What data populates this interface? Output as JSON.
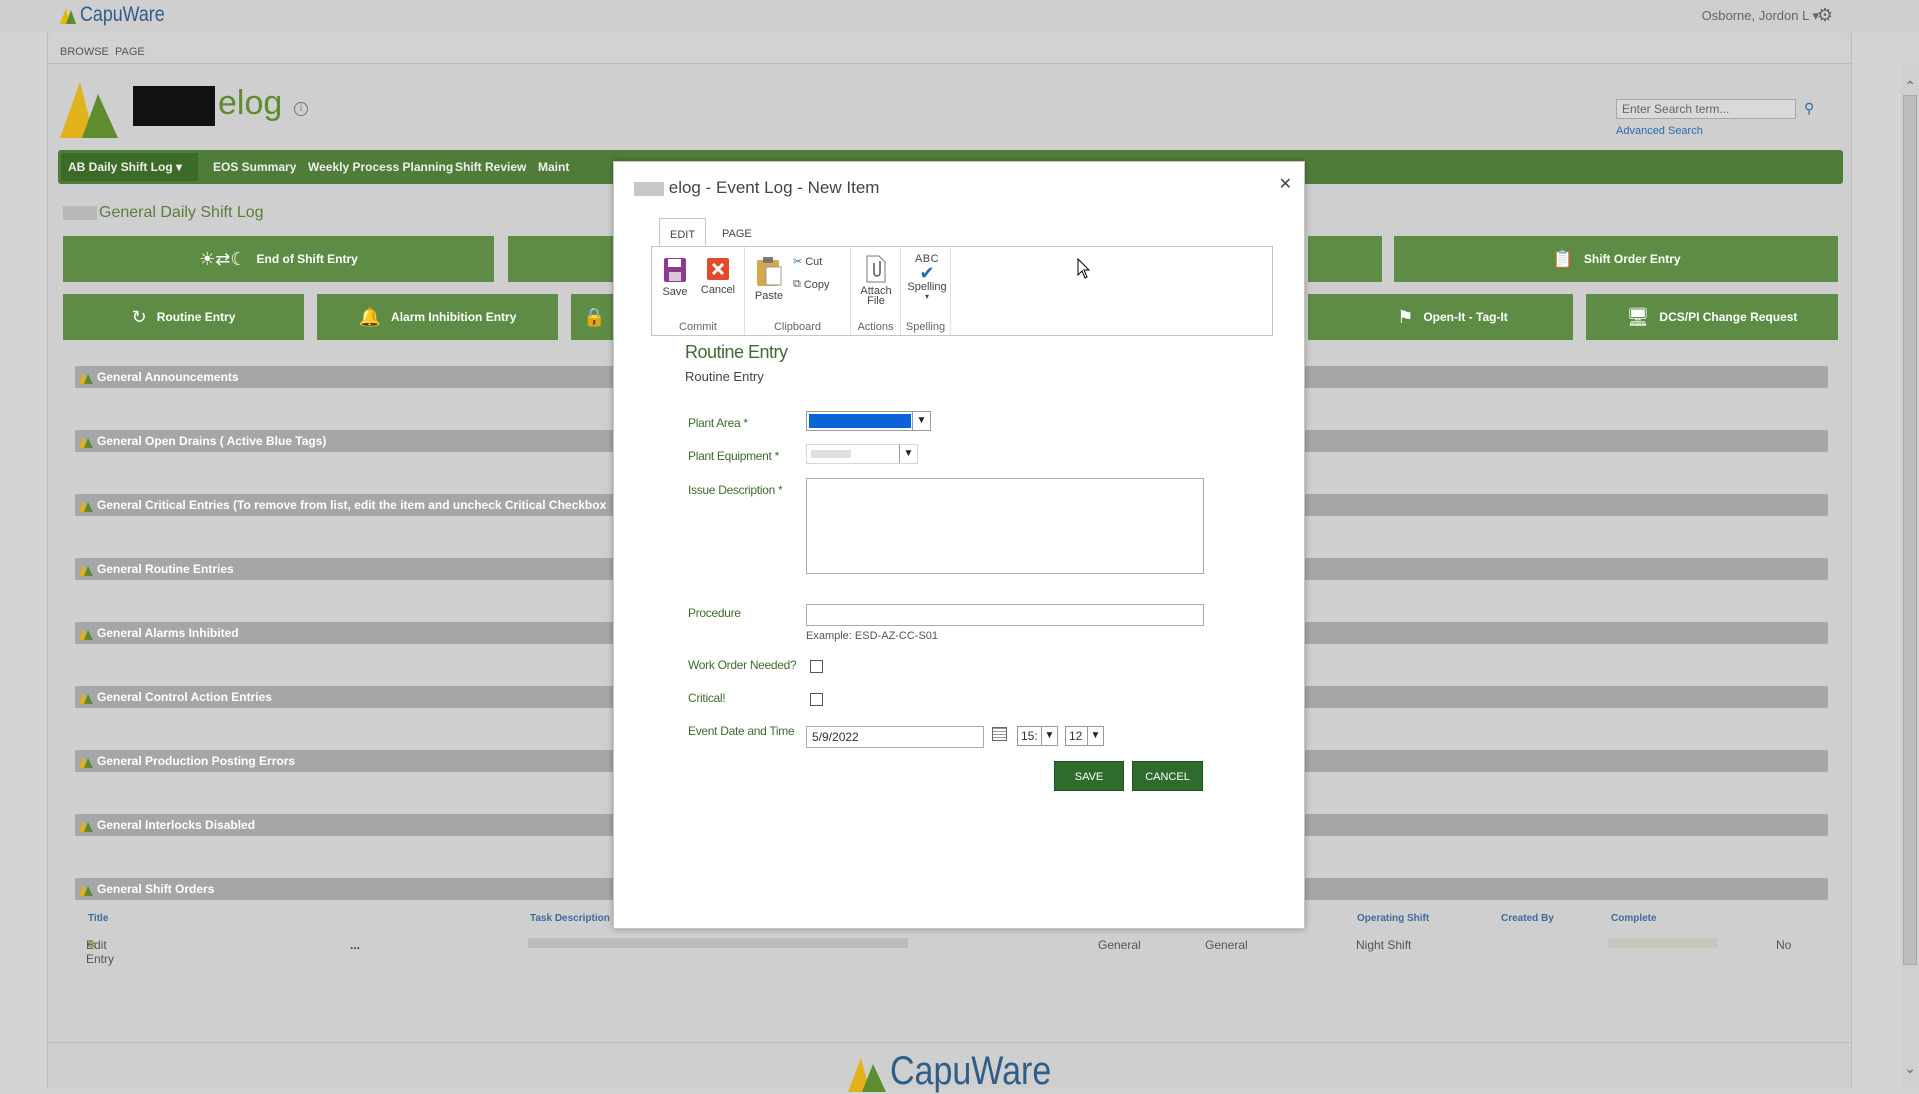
{
  "suitebar": {
    "brand": "CapuWare",
    "user": "Osborne, Jordon L",
    "user_caret": "▾"
  },
  "ribbon_tabs": {
    "browse": "BROWSE",
    "page": "PAGE"
  },
  "site": {
    "title": "elog",
    "search_placeholder": "Enter Search term...",
    "advanced_search": "Advanced Search"
  },
  "nav": {
    "items": [
      "AB Daily Shift Log ▾",
      "EOS Summary",
      "Weekly Process Planning",
      "Shift Review",
      "Maint"
    ]
  },
  "page_title": "General Daily Shift Log",
  "big_buttons": {
    "end_of_shift": "End of Shift Entry",
    "shift_order": "Shift Order Entry",
    "routine": "Routine Entry",
    "alarm_inhibition": "Alarm Inhibition Entry",
    "open_it_tag_it": "Open-It - Tag-It",
    "dcs_pi_change": "DCS/PI Change Request"
  },
  "sections": [
    "General Announcements",
    "General Open Drains ( Active Blue Tags)",
    "General Critical Entries (To remove from list, edit the item and uncheck Critical Checkbox",
    "General Routine Entries",
    "General Alarms Inhibited",
    "General Control Action Entries",
    "General Production Posting Errors",
    "General Interlocks Disabled",
    "General Shift Orders"
  ],
  "shift_orders": {
    "headers": {
      "title": "Title",
      "task_description": "Task Description",
      "operating_shift": "Operating Shift",
      "created_by": "Created By",
      "complete": "Complete"
    },
    "row": {
      "title": "Edit Entry",
      "ellipsis": "...",
      "col_a": "General",
      "col_b": "General",
      "operating_shift": "Night Shift",
      "complete": "No"
    }
  },
  "footer": {
    "brand": "CapuWare"
  },
  "dialog": {
    "title": "elog - Event Log - New Item",
    "close": "✕",
    "tabs": {
      "edit": "EDIT",
      "page": "PAGE"
    },
    "ribbon": {
      "save": "Save",
      "cancel": "Cancel",
      "commit_group": "Commit",
      "paste": "Paste",
      "cut": "Cut",
      "copy": "Copy",
      "clipboard_group": "Clipboard",
      "attach_file_1": "Attach",
      "attach_file_2": "File",
      "actions_group": "Actions",
      "abc": "ABC",
      "spelling": "Spelling",
      "spelling_caret": "▾",
      "spelling_group": "Spelling"
    },
    "form": {
      "heading": "Routine Entry",
      "subheading": "Routine Entry",
      "plant_area_label": "Plant Area",
      "plant_equipment_label": "Plant Equipment",
      "issue_description_label": "Issue Description",
      "required_marker": " *",
      "procedure_label": "Procedure",
      "procedure_value": "",
      "procedure_example": "Example: ESD-AZ-CC-S01",
      "work_order_label": "Work Order Needed?",
      "critical_label": "Critical!",
      "event_date_label": "Event Date and Time",
      "event_date_value": "5/9/2022",
      "hour_value": "15:",
      "minute_value": "12",
      "save_button": "SAVE",
      "cancel_button": "CANCEL"
    }
  },
  "colors": {
    "brand_green": "#4f7d39",
    "button_green": "#5e8c45",
    "dialog_button_green": "#2f6b2c",
    "form_label_green": "#3d6c2f",
    "select_highlight": "#0a64d8"
  }
}
